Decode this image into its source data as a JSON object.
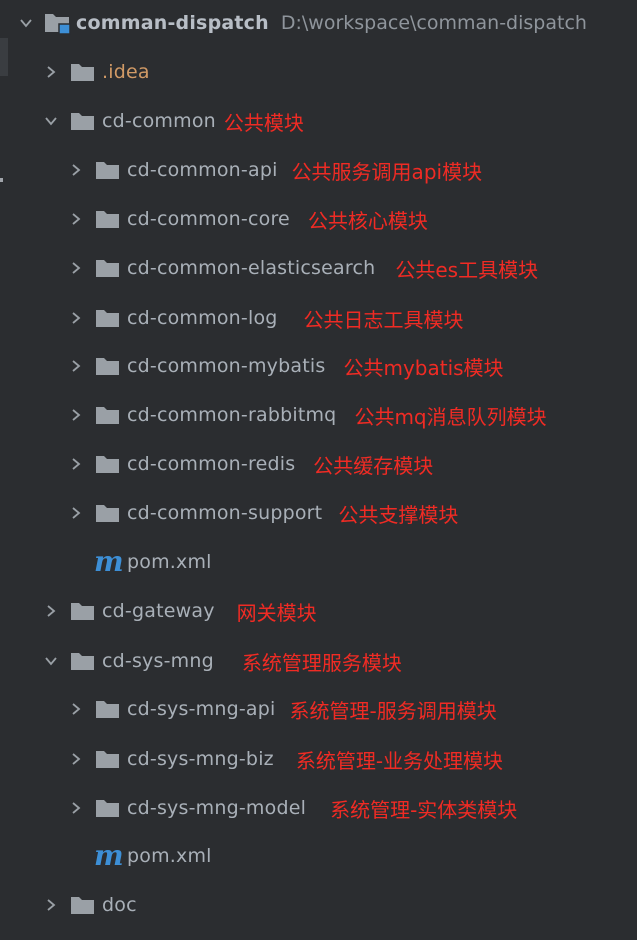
{
  "project": {
    "name": "comman-dispatch",
    "path": "D:\\workspace\\comman-dispatch"
  },
  "items": [
    {
      "name": ".idea",
      "note": ""
    },
    {
      "name": "cd-common",
      "note": "公共模块"
    },
    {
      "name": "cd-common-api",
      "note": "公共服务调用api模块"
    },
    {
      "name": "cd-common-core",
      "note": "公共核心模块"
    },
    {
      "name": "cd-common-elasticsearch",
      "note": "公共es工具模块"
    },
    {
      "name": "cd-common-log",
      "note": "公共日志工具模块"
    },
    {
      "name": "cd-common-mybatis",
      "note": "公共mybatis模块"
    },
    {
      "name": "cd-common-rabbitmq",
      "note": "公共mq消息队列模块"
    },
    {
      "name": "cd-common-redis",
      "note": "公共缓存模块"
    },
    {
      "name": "cd-common-support",
      "note": "公共支撑模块"
    },
    {
      "name": "pom.xml",
      "note": ""
    },
    {
      "name": "cd-gateway",
      "note": "网关模块"
    },
    {
      "name": "cd-sys-mng",
      "note": "系统管理服务模块"
    },
    {
      "name": "cd-sys-mng-api",
      "note": "系统管理-服务调用模块"
    },
    {
      "name": "cd-sys-mng-biz",
      "note": "系统管理-业务处理模块"
    },
    {
      "name": "cd-sys-mng-model",
      "note": "系统管理-实体类模块"
    },
    {
      "name": "pom.xml",
      "note": ""
    },
    {
      "name": "doc",
      "note": ""
    }
  ],
  "icons": {
    "folder": "folder-icon",
    "module": "module-folder-icon",
    "maven": "maven-pom-icon",
    "expanded": "chevron-down-icon",
    "collapsed": "chevron-right-icon"
  },
  "colors": {
    "background": "#2b2d30",
    "text": "#a9b0b8",
    "annotation": "#f02b24",
    "maven": "#3d8fd6",
    "idea": "#d19a66"
  }
}
